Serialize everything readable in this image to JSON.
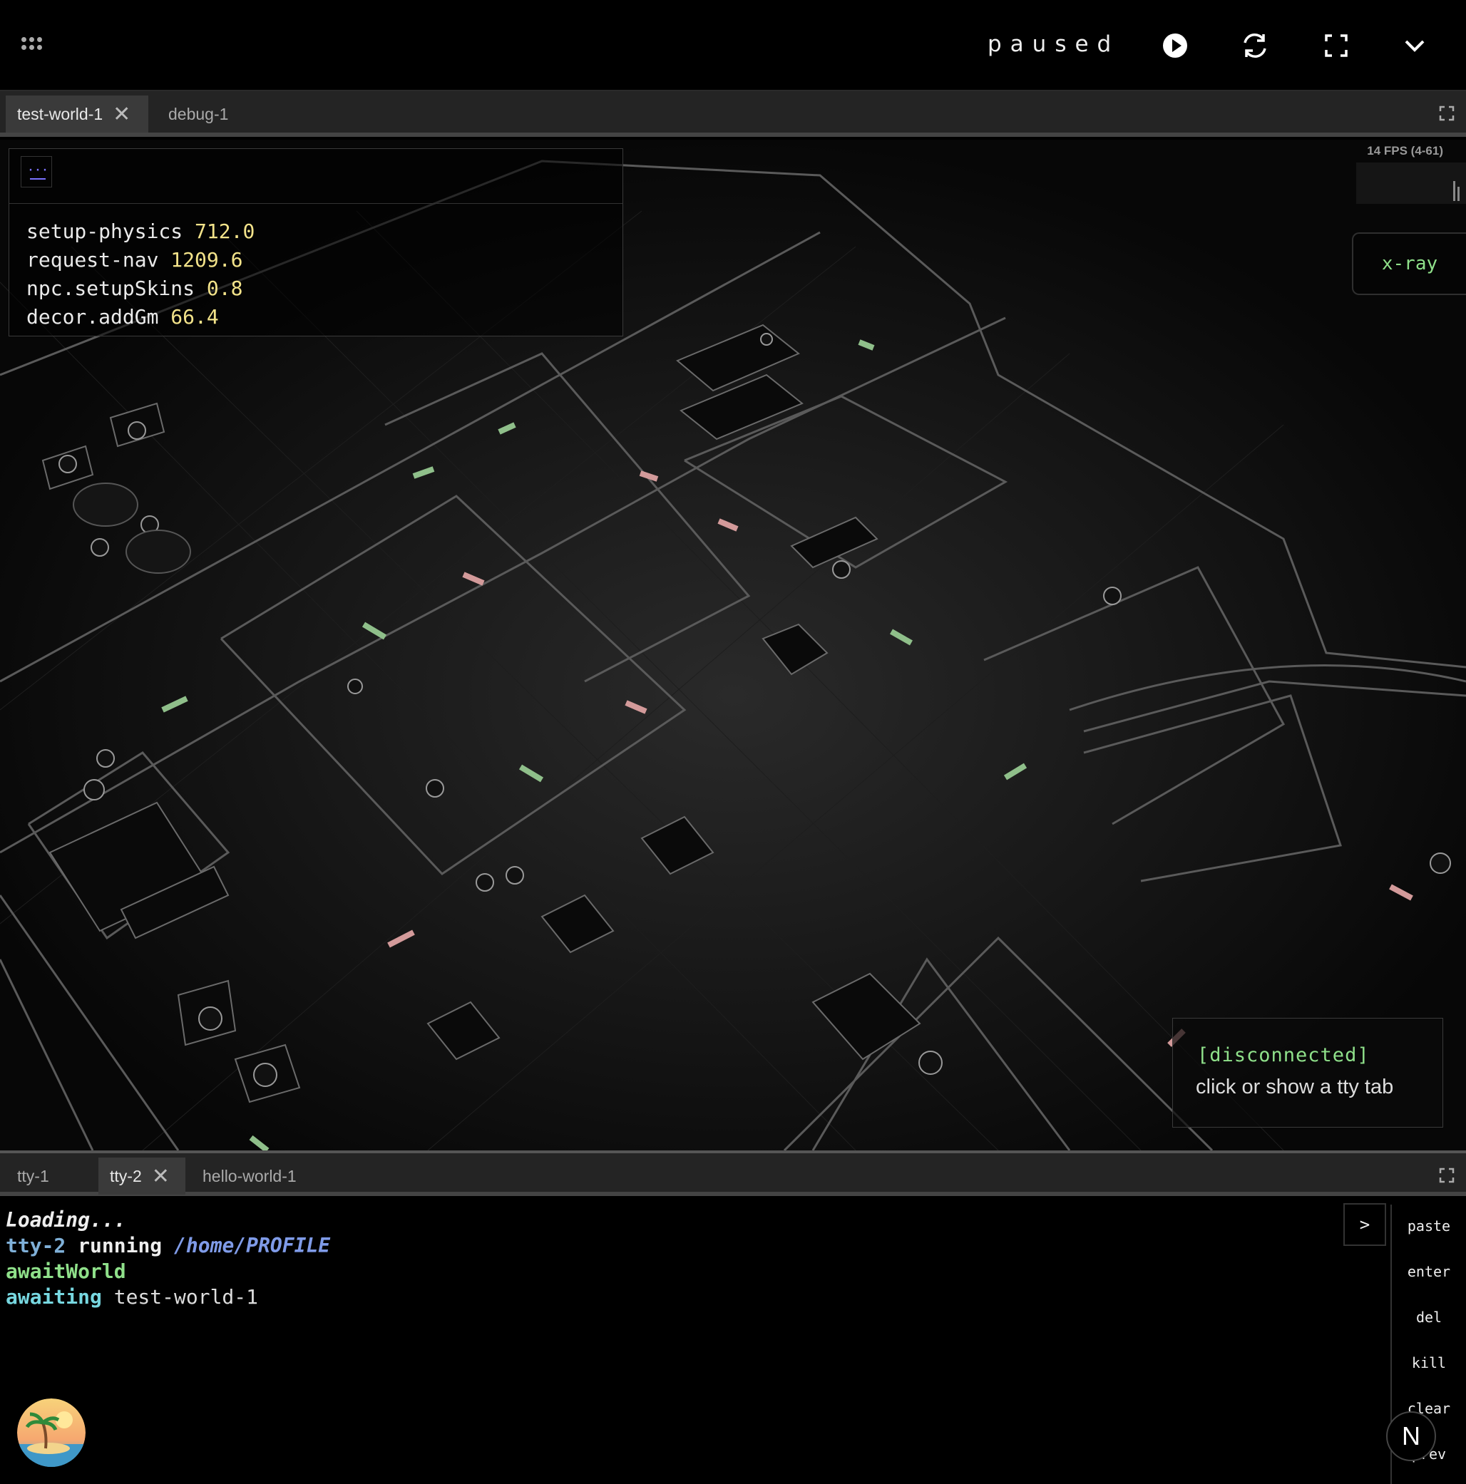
{
  "topbar": {
    "status": "paused",
    "icons": [
      "grid-icon",
      "play-icon",
      "refresh-icon",
      "fullscreen-icon",
      "chevron-down-icon"
    ]
  },
  "world_tabs": [
    {
      "label": "test-world-1",
      "active": true,
      "closable": true
    },
    {
      "label": "debug-1",
      "active": false,
      "closable": false
    }
  ],
  "world": {
    "log": [
      {
        "name": "setup-physics",
        "value": "712.0"
      },
      {
        "name": "request-nav",
        "value": "1209.6"
      },
      {
        "name": "npc.setupSkins",
        "value": "0.8"
      },
      {
        "name": "decor.addGm",
        "value": "66.4"
      }
    ],
    "fps": "14 FPS (4-61)",
    "xray_label": "x-ray",
    "disconnected": {
      "status": "[disconnected]",
      "hint": "click or show a tty tab"
    }
  },
  "tty_tabs": [
    {
      "label": "tty-1",
      "active": false,
      "closable": false
    },
    {
      "label": "tty-2",
      "active": true,
      "closable": true
    },
    {
      "label": "hello-world-1",
      "active": false,
      "closable": false
    }
  ],
  "terminal": {
    "line1": "Loading...",
    "line2a": "tty-2",
    "line2b": " running ",
    "line2c": "/home/PROFILE",
    "line3": "awaitWorld",
    "line4a": "awaiting",
    "line4b": " test-world-1"
  },
  "prompt_button": ">",
  "side_buttons": [
    "paste",
    "enter",
    "del",
    "kill",
    "clear",
    "prev"
  ],
  "badge": "N",
  "colors": {
    "accent_green": "#8fe08a",
    "value_yellow": "#f3e38a",
    "menu_purple": "#7a72ff"
  }
}
